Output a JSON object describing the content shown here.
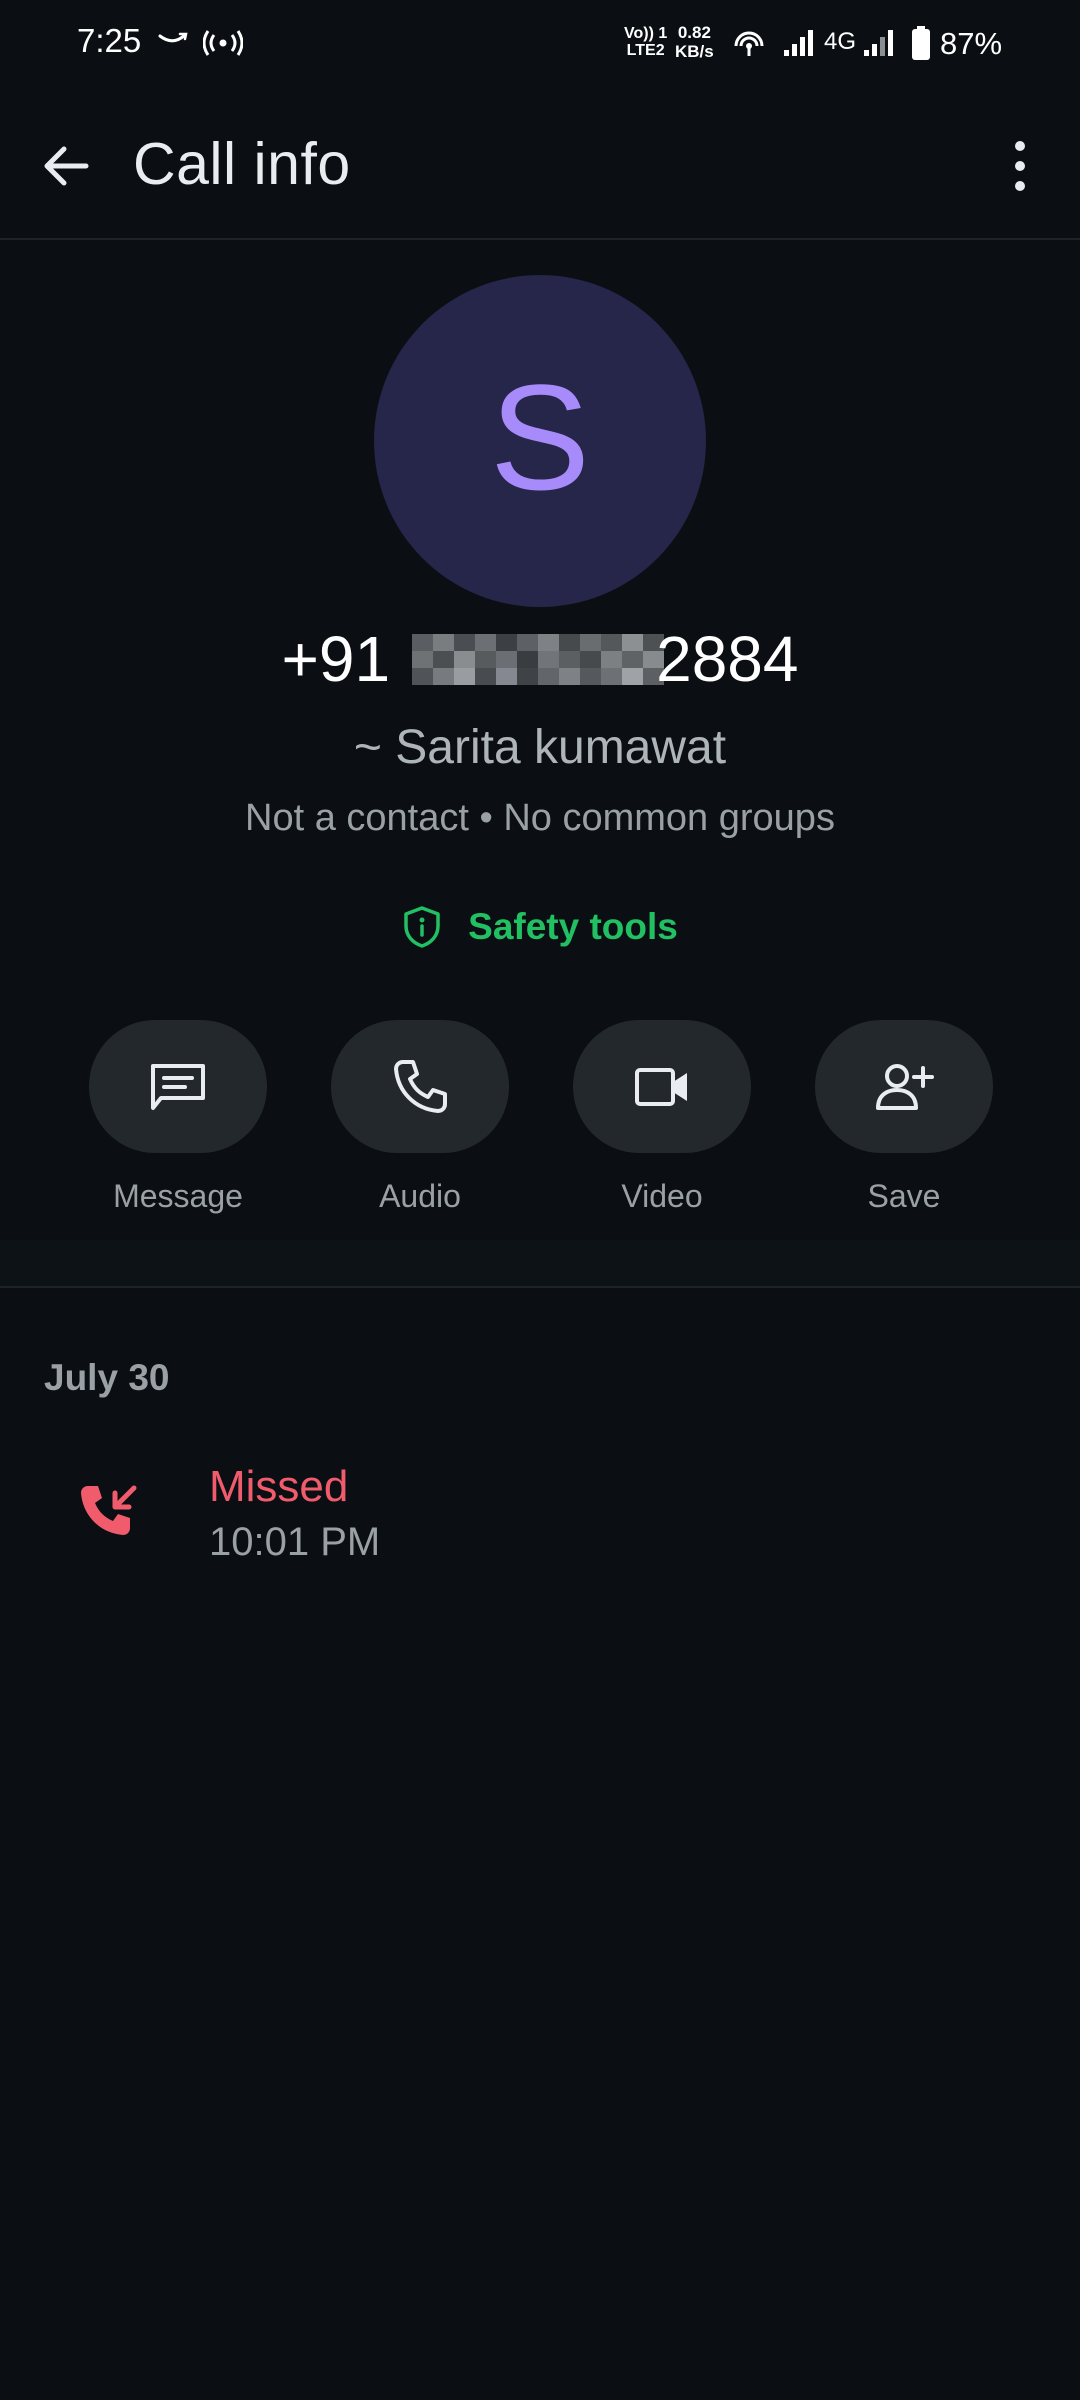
{
  "status_bar": {
    "time": "7:25",
    "volte_line1": "Vo)) 1",
    "volte_line2": "LTE2",
    "speed_value": "0.82",
    "speed_unit": "KB/s",
    "network": "4G",
    "battery": "87%"
  },
  "header": {
    "title": "Call info"
  },
  "profile": {
    "avatar_initial": "S",
    "phone_prefix": "+91",
    "phone_suffix": "2884",
    "push_name": "~ Sarita kumawat",
    "subtitle": "Not a contact • No common groups"
  },
  "safety": {
    "label": "Safety tools"
  },
  "actions": [
    {
      "label": "Message",
      "icon": "message-icon"
    },
    {
      "label": "Audio",
      "icon": "phone-icon"
    },
    {
      "label": "Video",
      "icon": "video-icon"
    },
    {
      "label": "Save",
      "icon": "add-person-icon"
    }
  ],
  "history": {
    "date": "July 30",
    "calls": [
      {
        "status": "Missed",
        "time": "10:01 PM",
        "icon": "missed-call-icon"
      }
    ]
  },
  "colors": {
    "background": "#0b0f13",
    "accent_green": "#21c063",
    "missed_red": "#f15c6d",
    "avatar_bg": "#25264a",
    "avatar_fg": "#a78bfa"
  }
}
